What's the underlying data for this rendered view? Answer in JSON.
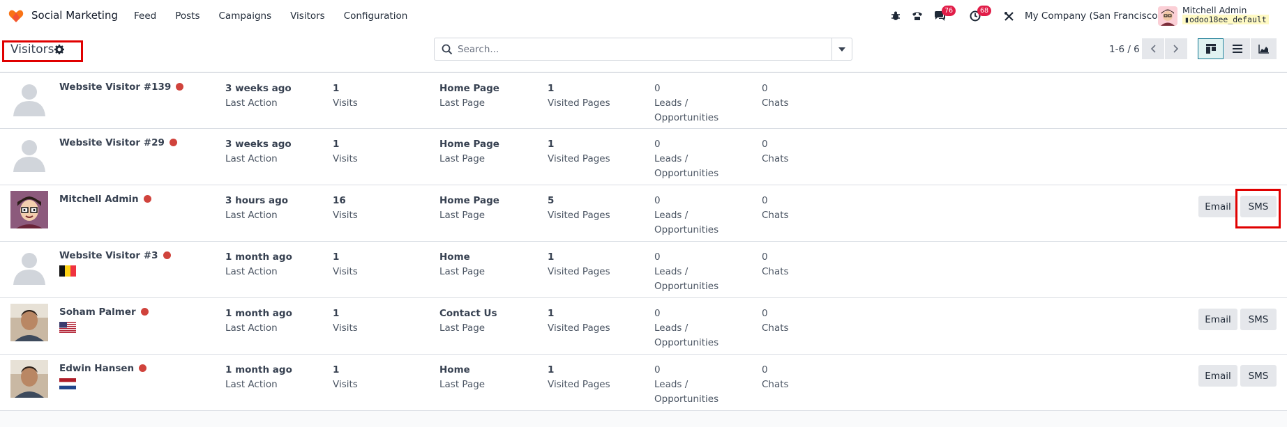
{
  "navbar": {
    "app_name": "Social Marketing",
    "menu": [
      "Feed",
      "Posts",
      "Campaigns",
      "Visitors",
      "Configuration"
    ],
    "messages_count": "76",
    "activities_count": "68",
    "company": "My Company (San Francisco)",
    "user_name": "Mitchell Admin",
    "database": "odoo18ee_default"
  },
  "control_panel": {
    "title": "Visitors",
    "search_placeholder": "Search...",
    "pager": "1-6 / 6"
  },
  "columns": {
    "last_action": "Last Action",
    "visits": "Visits",
    "last_page": "Last Page",
    "visited_pages": "Visited Pages",
    "leads_line1": "Leads /",
    "leads_line2": "Opportunities",
    "chats": "Chats"
  },
  "buttons": {
    "email": "Email",
    "sms": "SMS"
  },
  "visitors": [
    {
      "name": "Website Visitor #139",
      "last_action": "3 weeks ago",
      "visits": "1",
      "last_page": "Home Page",
      "visited_pages": "1",
      "leads": "0",
      "chats": "0",
      "avatar": "placeholder",
      "flag": ""
    },
    {
      "name": "Website Visitor #29",
      "last_action": "3 weeks ago",
      "visits": "1",
      "last_page": "Home Page",
      "visited_pages": "1",
      "leads": "0",
      "chats": "0",
      "avatar": "placeholder",
      "flag": ""
    },
    {
      "name": "Mitchell Admin",
      "last_action": "3 hours ago",
      "visits": "16",
      "last_page": "Home Page",
      "visited_pages": "5",
      "leads": "0",
      "chats": "0",
      "avatar": "cartoon",
      "flag": ""
    },
    {
      "name": "Website Visitor #3",
      "last_action": "1 month ago",
      "visits": "1",
      "last_page": "Home",
      "visited_pages": "1",
      "leads": "0",
      "chats": "0",
      "avatar": "placeholder",
      "flag": "belgium"
    },
    {
      "name": "Soham Palmer",
      "last_action": "1 month ago",
      "visits": "1",
      "last_page": "Contact Us",
      "visited_pages": "1",
      "leads": "0",
      "chats": "0",
      "avatar": "photo",
      "flag": "usa"
    },
    {
      "name": "Edwin Hansen",
      "last_action": "1 month ago",
      "visits": "1",
      "last_page": "Home",
      "visited_pages": "1",
      "leads": "0",
      "chats": "0",
      "avatar": "photo",
      "flag": "netherlands"
    }
  ],
  "colors": {
    "online_dot": "#d0433c",
    "highlight": "#e00000",
    "badge": "#e11d48",
    "active_view": "#0e7490"
  }
}
